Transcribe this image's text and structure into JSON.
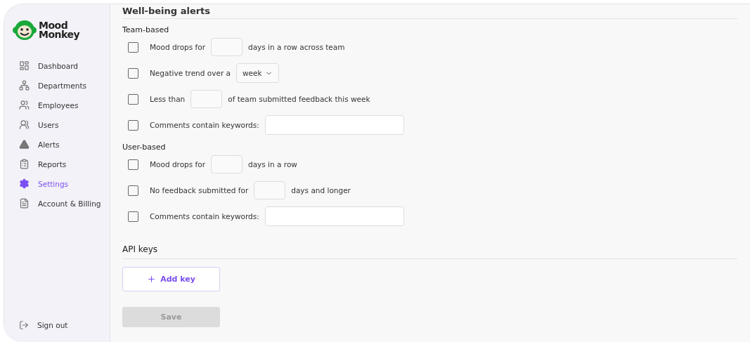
{
  "brand": {
    "name_line_1": "Mood",
    "name_line_2": "Monkey"
  },
  "sidebar": {
    "items": [
      {
        "label": "Dashboard",
        "selected": false
      },
      {
        "label": "Departments",
        "selected": false
      },
      {
        "label": "Employees",
        "selected": false
      },
      {
        "label": "Users",
        "selected": false
      },
      {
        "label": "Alerts",
        "selected": false
      },
      {
        "label": "Reports",
        "selected": false
      },
      {
        "label": "Settings",
        "selected": true
      },
      {
        "label": "Account & Billing",
        "selected": false
      }
    ],
    "sign_out": "Sign out"
  },
  "alerts": {
    "title": "Well-being alerts",
    "groups": [
      {
        "title": "Team-based",
        "rules": [
          {
            "checked": false,
            "parts": [
              {
                "kind": "text",
                "text": "Mood drops for"
              },
              {
                "kind": "number"
              },
              {
                "kind": "text",
                "text": "days in a row across team"
              }
            ]
          },
          {
            "checked": false,
            "parts": [
              {
                "kind": "text",
                "text": "Negative trend over a"
              },
              {
                "kind": "select",
                "value": "week"
              }
            ]
          },
          {
            "checked": false,
            "parts": [
              {
                "kind": "text",
                "text": "Less than"
              },
              {
                "kind": "number"
              },
              {
                "kind": "text",
                "text": "of team submitted feedback this week"
              }
            ]
          },
          {
            "checked": false,
            "parts": [
              {
                "kind": "text",
                "text": "Comments contain keywords:"
              },
              {
                "kind": "keywords"
              }
            ]
          }
        ]
      },
      {
        "title": "User-based",
        "rules": [
          {
            "checked": false,
            "parts": [
              {
                "kind": "text",
                "text": "Mood drops for"
              },
              {
                "kind": "number"
              },
              {
                "kind": "text",
                "text": "days in a row"
              }
            ]
          },
          {
            "checked": false,
            "parts": [
              {
                "kind": "text",
                "text": "No feedback submitted for"
              },
              {
                "kind": "number"
              },
              {
                "kind": "text",
                "text": "days and longer"
              }
            ]
          },
          {
            "checked": false,
            "parts": [
              {
                "kind": "text",
                "text": "Comments contain keywords:"
              },
              {
                "kind": "keywords"
              }
            ]
          }
        ]
      }
    ]
  },
  "api_keys": {
    "title": "API keys",
    "add_button": "Add key"
  },
  "save_button": {
    "label": "Save",
    "disabled": true
  }
}
